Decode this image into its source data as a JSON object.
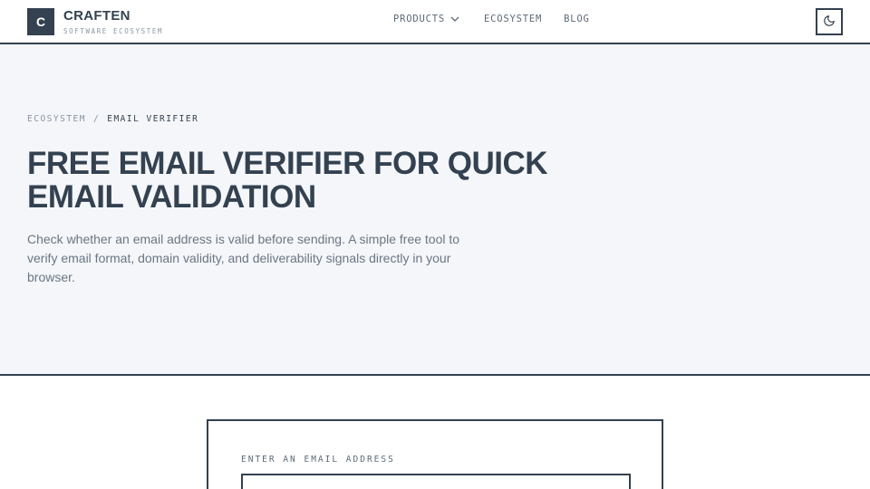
{
  "header": {
    "logo_letter": "C",
    "brand_name": "CRAFTEN",
    "brand_tagline": "SOFTWARE ECOSYSTEM",
    "nav": [
      {
        "label": "PRODUCTS",
        "has_dropdown": true
      },
      {
        "label": "ECOSYSTEM"
      },
      {
        "label": "BLOG"
      }
    ],
    "theme_toggle_icon": "moon-icon"
  },
  "hero": {
    "breadcrumb": {
      "parent": "ECOSYSTEM",
      "separator": "/",
      "current": "EMAIL VERIFIER"
    },
    "title": "FREE EMAIL VERIFIER FOR QUICK EMAIL VALIDATION",
    "description": "Check whether an email address is valid before sending. A simple free tool to verify email format, domain validity, and deliverability signals directly in your browser."
  },
  "verifier": {
    "field_label": "ENTER AN EMAIL ADDRESS",
    "input_value": "",
    "input_placeholder": ""
  },
  "colors": {
    "primary": "#334150",
    "hero_background": "#f4f6f9",
    "muted_text": "#6b7684"
  }
}
